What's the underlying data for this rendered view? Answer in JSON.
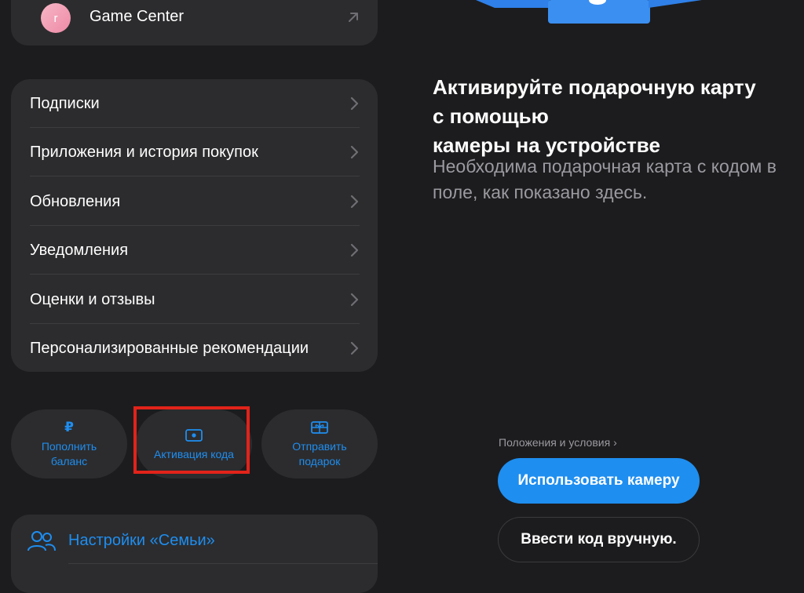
{
  "game_center": {
    "avatar_letter": "r",
    "label": "Game Center"
  },
  "settings_list": {
    "items": [
      {
        "label": "Подписки"
      },
      {
        "label": "Приложения и история покупок"
      },
      {
        "label": "Обновления"
      },
      {
        "label": "Уведомления"
      },
      {
        "label": "Оценки и отзывы"
      },
      {
        "label": "Персонализированные рекомендации"
      }
    ]
  },
  "actions": {
    "top_up": {
      "icon": "₽",
      "line1": "Пополнить",
      "line2": "баланс"
    },
    "redeem": {
      "label": "Активация кода"
    },
    "send_gift": {
      "line1": "Отправить",
      "line2": "подарок"
    }
  },
  "family": {
    "label": "Настройки «Семьи»"
  },
  "redeem_panel": {
    "heading_line1": "Активируйте подарочную карту",
    "heading_line2": "с помощью",
    "heading_line3": "камеры на устройстве",
    "subtext": "Необходима подарочная карта с кодом в поле, как показано здесь.",
    "terms_label": "Положения и условия",
    "use_camera_label": "Использовать камеру",
    "enter_manually_label": "Ввести код вручную."
  },
  "colors": {
    "accent": "#1e8ef0",
    "highlight": "#e2231a",
    "background": "#1c1c1e",
    "card": "#2c2c2e"
  }
}
